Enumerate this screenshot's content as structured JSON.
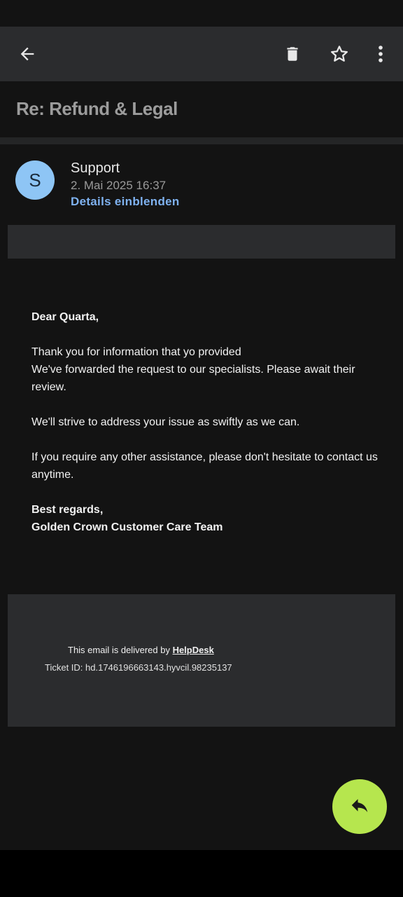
{
  "toolbar": {
    "icons": [
      "back-arrow-icon",
      "trash-icon",
      "star-icon",
      "more-vert-icon"
    ]
  },
  "email": {
    "subject": "Re: Refund & Legal",
    "sender": "Support",
    "avatar_letter": "S",
    "date": "2. Mai 2025 16:37",
    "details_link": "Details einblenden",
    "body": {
      "greeting": "Dear Quarta,",
      "line1": "Thank you for information that yo provided",
      "line2": "We've forwarded the request to our specialists. Please await their review.",
      "line3": "We'll strive to address your issue as swiftly as we can.",
      "line4": "If you require any other assistance, please don't hesitate to contact us anytime.",
      "signoff": "Best regards,",
      "team": "Golden Crown Customer Care Team"
    },
    "footer": {
      "delivered_prefix": "This email is delivered by ",
      "delivered_link": "HelpDesk",
      "ticket": "Ticket ID: hd.1746196663143.hyvcil.98235137"
    }
  },
  "colors": {
    "background": "#131313",
    "toolbar": "#2b2c2e",
    "avatar": "#8ec5f5",
    "link": "#7fb2f0",
    "fab": "#b6e64e"
  },
  "fab": {
    "icon": "reply-icon"
  }
}
